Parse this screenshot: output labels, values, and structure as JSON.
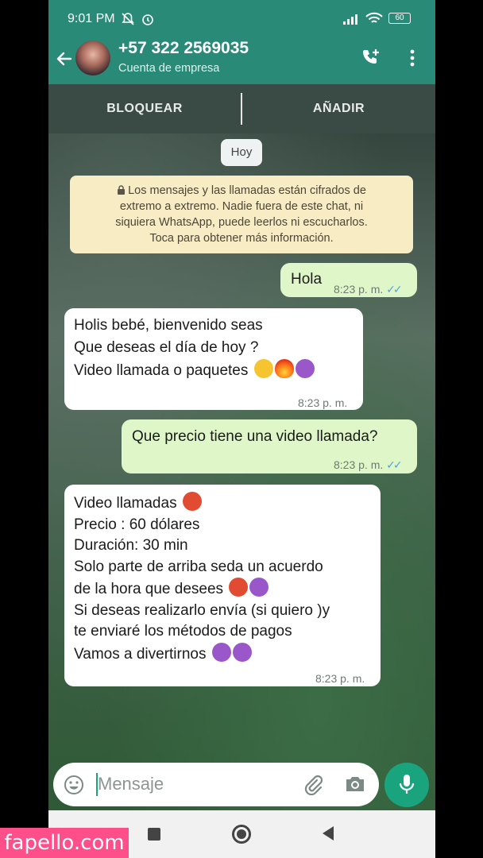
{
  "status_bar": {
    "time": "9:01 PM",
    "battery": "60"
  },
  "header": {
    "contact_name": "+57 322 2569035",
    "subtitle": "Cuenta de empresa"
  },
  "action_bar": {
    "block_label": "BLOQUEAR",
    "add_label": "AÑADIR"
  },
  "date_chip": "Hoy",
  "encryption_notice": {
    "lines": [
      "Los mensajes y las llamadas están cifrados de",
      "extremo a extremo. Nadie fuera de este chat, ni",
      "siquiera WhatsApp, puede leerlos ni escucharlos.",
      "Toca para obtener más información."
    ]
  },
  "messages": [
    {
      "direction": "outgoing",
      "lines": [
        "Hola"
      ],
      "time": "8:23 p. m.",
      "read": true
    },
    {
      "direction": "incoming",
      "lines": [
        "Holis  bebé,  bienvenido seas",
        "Que deseas el día de hoy ?",
        "Video llamada o paquetes"
      ],
      "emojis": [
        "face-blowing-kiss",
        "fire",
        "smiling-devil"
      ],
      "time": "8:23 p. m."
    },
    {
      "direction": "outgoing",
      "lines": [
        "Que precio tiene una video llamada?"
      ],
      "time": "8:23 p. m.",
      "read": true
    },
    {
      "direction": "incoming",
      "lines": [
        "Video llamadas",
        "Precio : 60 dólares",
        "Duración: 30 min",
        "Solo parte de arriba  seda un acuerdo",
        "de la hora que desees",
        "Si deseas realizarlo envía (si quiero )y",
        "te enviaré los métodos de pagos",
        "Vamos a divertirnos"
      ],
      "time": "8:23 p. m."
    }
  ],
  "composer": {
    "placeholder": "Mensaje"
  },
  "watermark": "fapello.com",
  "colors": {
    "header_green": "#2a8a78",
    "outgoing_bubble": "#dff7c8",
    "incoming_bubble": "#ffffff",
    "notice_bg": "#f7ecc4",
    "mic_button": "#1aa47e",
    "read_ticks": "#4fa3e0",
    "watermark_bg": "#ff4f8b"
  }
}
